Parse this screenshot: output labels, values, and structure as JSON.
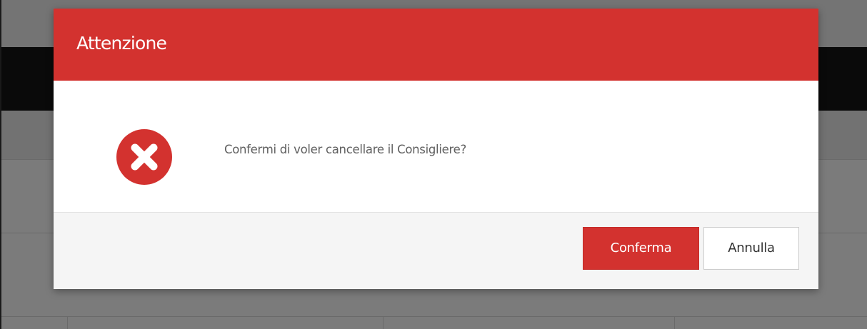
{
  "dialog": {
    "title": "Attenzione",
    "message": "Confermi di voler cancellare il Consigliere?",
    "icon": "error-circle-x-icon",
    "confirm_label": "Conferma",
    "cancel_label": "Annulla"
  },
  "colors": {
    "accent": "#d3322f",
    "overlay": "#6b6b6b",
    "navbar": "#0a0a0a",
    "footer": "#f5f5f5",
    "message_text": "#606060"
  }
}
